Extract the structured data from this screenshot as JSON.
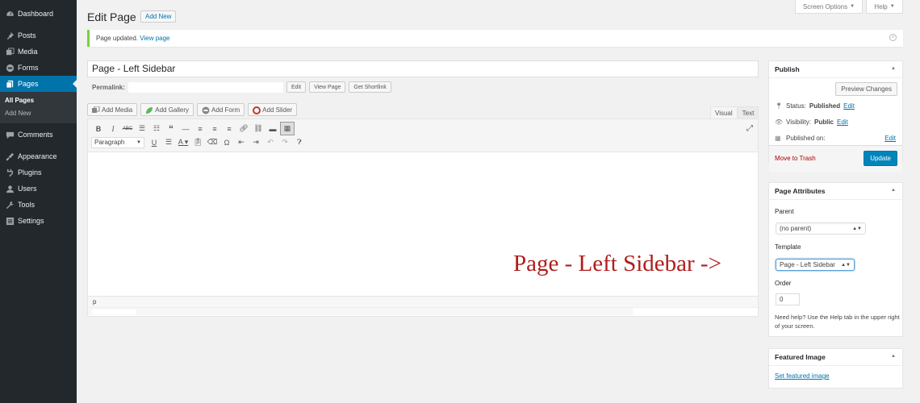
{
  "sidebar": {
    "items": [
      {
        "label": "Dashboard",
        "icon": "dashboard-icon"
      },
      {
        "label": "Posts",
        "icon": "pin-icon"
      },
      {
        "label": "Media",
        "icon": "media-icon"
      },
      {
        "label": "Forms",
        "icon": "forms-icon"
      },
      {
        "label": "Pages",
        "icon": "pages-icon",
        "current": true
      },
      {
        "label": "Comments",
        "icon": "comments-icon"
      },
      {
        "label": "Appearance",
        "icon": "appearance-icon"
      },
      {
        "label": "Plugins",
        "icon": "plugins-icon"
      },
      {
        "label": "Users",
        "icon": "users-icon"
      },
      {
        "label": "Tools",
        "icon": "tools-icon"
      },
      {
        "label": "Settings",
        "icon": "settings-icon"
      }
    ],
    "submenu": [
      "All Pages",
      "Add New"
    ]
  },
  "header": {
    "screen_options": "Screen Options",
    "help": "Help",
    "title": "Edit Page",
    "add_new": "Add New"
  },
  "notice": {
    "text": "Page updated.",
    "link": "View page"
  },
  "post": {
    "title": "Page - Left Sidebar",
    "permalink_label": "Permalink:",
    "edit_btn": "Edit",
    "view_btn": "View Page",
    "shortlink_btn": "Get Shortlink"
  },
  "media_buttons": [
    "Add Media",
    "Add Gallery",
    "Add Form",
    "Add Slider"
  ],
  "editor": {
    "tab_visual": "Visual",
    "tab_text": "Text",
    "format_select": "Paragraph",
    "path": "p"
  },
  "publish": {
    "title": "Publish",
    "preview": "Preview Changes",
    "status_label": "Status:",
    "status_value": "Published",
    "visibility_label": "Visibility:",
    "visibility_value": "Public",
    "published_on": "Published on:",
    "edit": "Edit",
    "trash": "Move to Trash",
    "update": "Update"
  },
  "attributes": {
    "title": "Page Attributes",
    "parent_label": "Parent",
    "parent_value": "(no parent)",
    "template_label": "Template",
    "template_value": "Page - Left Sidebar",
    "order_label": "Order",
    "order_value": "0",
    "help": "Need help? Use the Help tab in the upper right of your screen."
  },
  "featured": {
    "title": "Featured Image",
    "link": "Set featured image"
  },
  "annotation": "Page - Left Sidebar ->",
  "colors": {
    "accent": "#0073aa",
    "sidebar": "#23282d",
    "notice": "#7ad03a",
    "annotation": "#b11c1c",
    "primary_button": "#0085ba"
  }
}
